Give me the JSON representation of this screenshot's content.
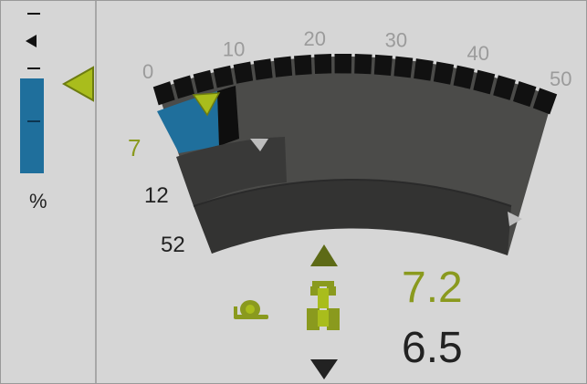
{
  "gauge": {
    "scale_labels": [
      "0",
      "10",
      "20",
      "30",
      "40",
      "50"
    ],
    "scale_min": 0,
    "scale_max": 50,
    "target_value": 7,
    "current_value": 12,
    "secondary_value": 52,
    "side_labels": {
      "target": "7",
      "current": "12",
      "secondary": "52"
    },
    "colors": {
      "accent": "#9aad1a",
      "fill_blue": "#1f6f9c",
      "band_dark": "#383838",
      "band_mid": "#4a4a48",
      "scale_black": "#111111"
    }
  },
  "level_bar": {
    "unit": "%",
    "fill_fraction": 0.58
  },
  "readouts": {
    "upper_value": "7.2",
    "lower_value": "6.5"
  },
  "icons": {
    "speed_mode": "snail-icon",
    "vehicle": "tractor-icon",
    "increase": "triangle-up-icon",
    "decrease": "triangle-down-icon"
  }
}
